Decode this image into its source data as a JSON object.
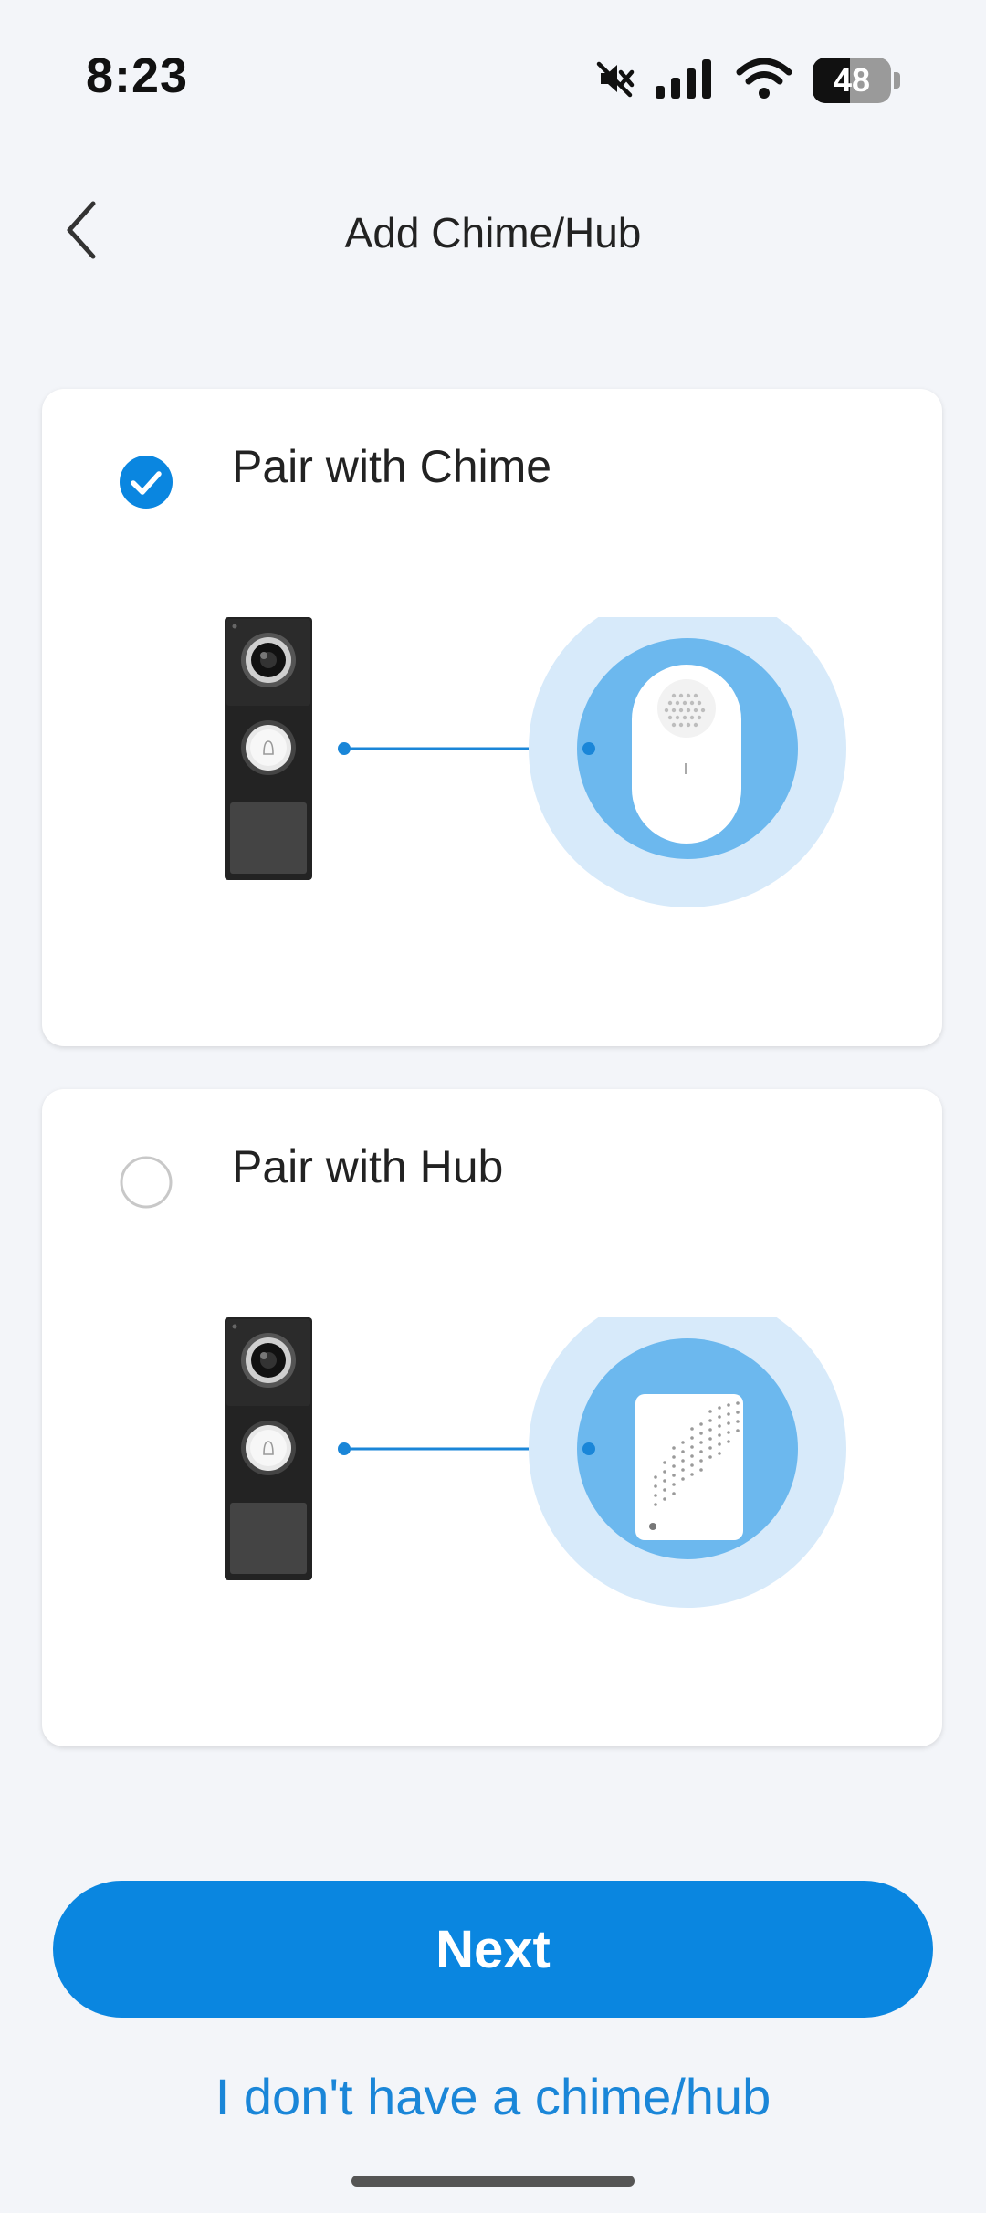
{
  "status_bar": {
    "time": "8:23",
    "battery_percent": "48",
    "icons": [
      "mute-icon",
      "signal-icon",
      "wifi-icon",
      "battery-icon"
    ]
  },
  "header": {
    "title": "Add Chime/Hub",
    "back_icon": "chevron-left-icon"
  },
  "options": [
    {
      "label": "Pair with Chime",
      "selected": true,
      "device": "chime"
    },
    {
      "label": "Pair with Hub",
      "selected": false,
      "device": "hub"
    }
  ],
  "actions": {
    "next_label": "Next",
    "no_device_label": "I don't have a chime/hub"
  },
  "colors": {
    "accent": "#0a86e0",
    "link": "#1a86d8",
    "background": "#f3f5f9",
    "halo_outer": "#d7eafa",
    "halo_inner": "#6cb8ee"
  }
}
